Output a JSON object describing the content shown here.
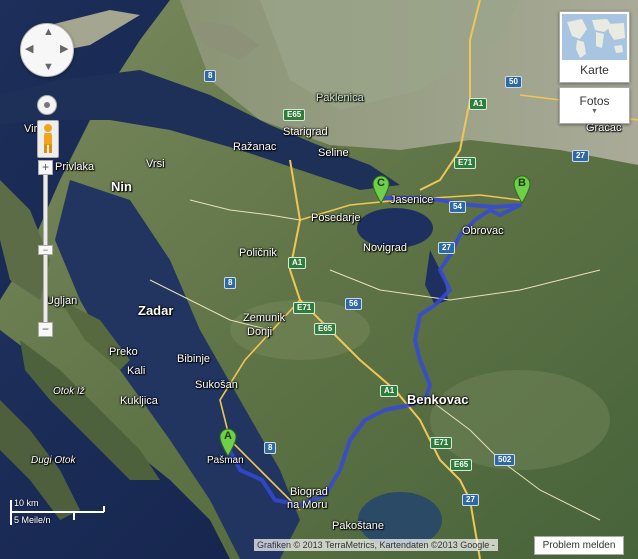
{
  "map_type": {
    "label": "Karte"
  },
  "photos": {
    "label": "Fotos"
  },
  "scale": {
    "km": "10 km",
    "miles": "5 Meile/n"
  },
  "copyright": "Grafiken © 2013 TerraMetrics, Kartendaten ©2013 Google -",
  "report_button": "Problem melden",
  "markers": {
    "a": "A",
    "b": "B",
    "c": "C"
  },
  "places": {
    "paklenica": "Paklenica",
    "starigrad": "Starigrad",
    "razanac": "Ražanac",
    "seline": "Seline",
    "jasenice": "Jasenice",
    "gracac": "Gračac",
    "obrovac": "Obrovac",
    "posedarje": "Posedarje",
    "novigrad": "Novigrad",
    "policnik": "Poličnik",
    "zadar": "Zadar",
    "zemunik": "Zemunik",
    "zemunik2": "Donji",
    "nin": "Nin",
    "vrsi": "Vrsi",
    "privlaka": "Privlaka",
    "vir": "Vir",
    "ugljan": "Ugljan",
    "preko": "Preko",
    "kali": "Kali",
    "kukljica": "Kukljica",
    "otok_iz": "Otok Iž",
    "dugi_otok": "Dugi Otok",
    "bibinje": "Bibinje",
    "sukosan": "Sukošan",
    "benkovac": "Benkovac",
    "biograd1": "Biograd",
    "biograd2": "na Moru",
    "pasman": "Pašman",
    "pakostane": "Pakoštane"
  },
  "roads": {
    "r8a": "8",
    "r8b": "8",
    "r8c": "8",
    "e65a": "E65",
    "e65b": "E65",
    "e65c": "E65",
    "a1a": "A1",
    "a1b": "A1",
    "a1c": "A1",
    "e71a": "E71",
    "e71b": "E71",
    "e71c": "E71",
    "r50": "50",
    "r54": "54",
    "r27a": "27",
    "r27b": "27",
    "r27c": "27",
    "r56": "56",
    "r502": "502"
  }
}
